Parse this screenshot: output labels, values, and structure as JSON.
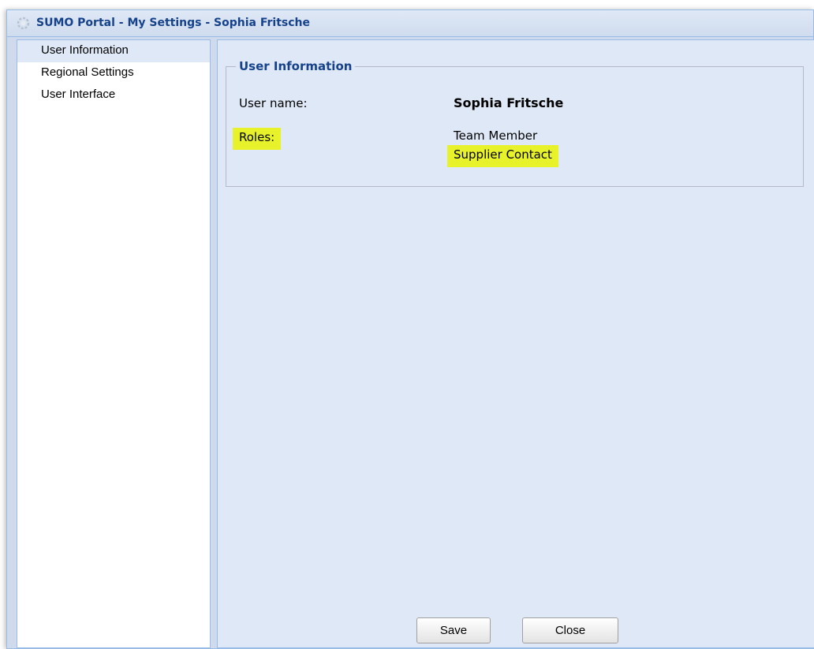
{
  "window": {
    "title": "SUMO Portal - My Settings - Sophia Fritsche",
    "title_icon": "loading-spinner-icon"
  },
  "sidebar": {
    "items": [
      {
        "label": "User Information",
        "selected": true
      },
      {
        "label": "Regional Settings",
        "selected": false
      },
      {
        "label": "User Interface",
        "selected": false
      }
    ]
  },
  "panel": {
    "legend": "User Information",
    "user_name_label": "User name:",
    "user_name_value": "Sophia Fritsche",
    "roles_label": "Roles:",
    "roles": [
      "Team Member",
      "Supplier Contact"
    ],
    "highlight_color": "#e8f22a"
  },
  "buttons": {
    "save_label": "Save",
    "close_label": "Close"
  },
  "colors": {
    "title_text": "#15428b",
    "panel_bg": "#dfe8f6",
    "border": "#99bbe8"
  }
}
